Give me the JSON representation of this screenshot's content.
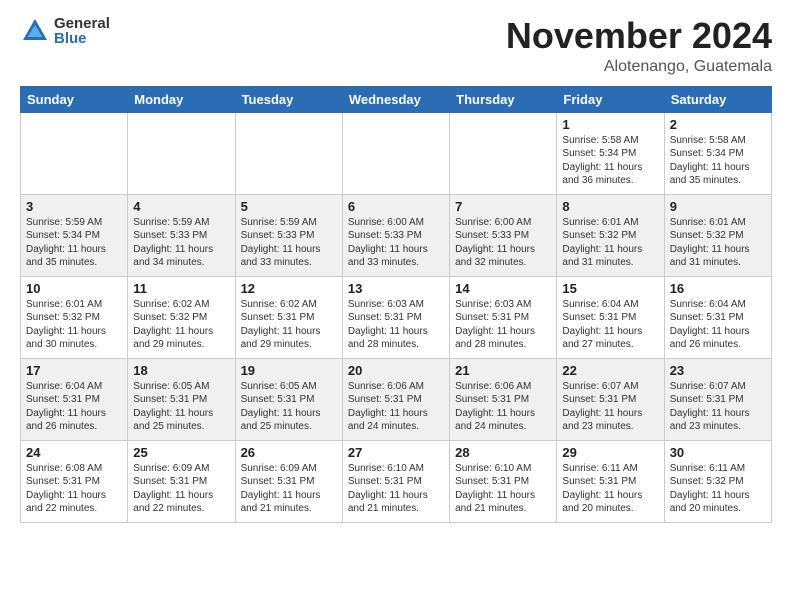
{
  "header": {
    "logo_general": "General",
    "logo_blue": "Blue",
    "month_title": "November 2024",
    "location": "Alotenango, Guatemala"
  },
  "weekdays": [
    "Sunday",
    "Monday",
    "Tuesday",
    "Wednesday",
    "Thursday",
    "Friday",
    "Saturday"
  ],
  "weeks": [
    [
      {
        "day": "",
        "info": ""
      },
      {
        "day": "",
        "info": ""
      },
      {
        "day": "",
        "info": ""
      },
      {
        "day": "",
        "info": ""
      },
      {
        "day": "",
        "info": ""
      },
      {
        "day": "1",
        "info": "Sunrise: 5:58 AM\nSunset: 5:34 PM\nDaylight: 11 hours\nand 36 minutes."
      },
      {
        "day": "2",
        "info": "Sunrise: 5:58 AM\nSunset: 5:34 PM\nDaylight: 11 hours\nand 35 minutes."
      }
    ],
    [
      {
        "day": "3",
        "info": "Sunrise: 5:59 AM\nSunset: 5:34 PM\nDaylight: 11 hours\nand 35 minutes."
      },
      {
        "day": "4",
        "info": "Sunrise: 5:59 AM\nSunset: 5:33 PM\nDaylight: 11 hours\nand 34 minutes."
      },
      {
        "day": "5",
        "info": "Sunrise: 5:59 AM\nSunset: 5:33 PM\nDaylight: 11 hours\nand 33 minutes."
      },
      {
        "day": "6",
        "info": "Sunrise: 6:00 AM\nSunset: 5:33 PM\nDaylight: 11 hours\nand 33 minutes."
      },
      {
        "day": "7",
        "info": "Sunrise: 6:00 AM\nSunset: 5:33 PM\nDaylight: 11 hours\nand 32 minutes."
      },
      {
        "day": "8",
        "info": "Sunrise: 6:01 AM\nSunset: 5:32 PM\nDaylight: 11 hours\nand 31 minutes."
      },
      {
        "day": "9",
        "info": "Sunrise: 6:01 AM\nSunset: 5:32 PM\nDaylight: 11 hours\nand 31 minutes."
      }
    ],
    [
      {
        "day": "10",
        "info": "Sunrise: 6:01 AM\nSunset: 5:32 PM\nDaylight: 11 hours\nand 30 minutes."
      },
      {
        "day": "11",
        "info": "Sunrise: 6:02 AM\nSunset: 5:32 PM\nDaylight: 11 hours\nand 29 minutes."
      },
      {
        "day": "12",
        "info": "Sunrise: 6:02 AM\nSunset: 5:31 PM\nDaylight: 11 hours\nand 29 minutes."
      },
      {
        "day": "13",
        "info": "Sunrise: 6:03 AM\nSunset: 5:31 PM\nDaylight: 11 hours\nand 28 minutes."
      },
      {
        "day": "14",
        "info": "Sunrise: 6:03 AM\nSunset: 5:31 PM\nDaylight: 11 hours\nand 28 minutes."
      },
      {
        "day": "15",
        "info": "Sunrise: 6:04 AM\nSunset: 5:31 PM\nDaylight: 11 hours\nand 27 minutes."
      },
      {
        "day": "16",
        "info": "Sunrise: 6:04 AM\nSunset: 5:31 PM\nDaylight: 11 hours\nand 26 minutes."
      }
    ],
    [
      {
        "day": "17",
        "info": "Sunrise: 6:04 AM\nSunset: 5:31 PM\nDaylight: 11 hours\nand 26 minutes."
      },
      {
        "day": "18",
        "info": "Sunrise: 6:05 AM\nSunset: 5:31 PM\nDaylight: 11 hours\nand 25 minutes."
      },
      {
        "day": "19",
        "info": "Sunrise: 6:05 AM\nSunset: 5:31 PM\nDaylight: 11 hours\nand 25 minutes."
      },
      {
        "day": "20",
        "info": "Sunrise: 6:06 AM\nSunset: 5:31 PM\nDaylight: 11 hours\nand 24 minutes."
      },
      {
        "day": "21",
        "info": "Sunrise: 6:06 AM\nSunset: 5:31 PM\nDaylight: 11 hours\nand 24 minutes."
      },
      {
        "day": "22",
        "info": "Sunrise: 6:07 AM\nSunset: 5:31 PM\nDaylight: 11 hours\nand 23 minutes."
      },
      {
        "day": "23",
        "info": "Sunrise: 6:07 AM\nSunset: 5:31 PM\nDaylight: 11 hours\nand 23 minutes."
      }
    ],
    [
      {
        "day": "24",
        "info": "Sunrise: 6:08 AM\nSunset: 5:31 PM\nDaylight: 11 hours\nand 22 minutes."
      },
      {
        "day": "25",
        "info": "Sunrise: 6:09 AM\nSunset: 5:31 PM\nDaylight: 11 hours\nand 22 minutes."
      },
      {
        "day": "26",
        "info": "Sunrise: 6:09 AM\nSunset: 5:31 PM\nDaylight: 11 hours\nand 21 minutes."
      },
      {
        "day": "27",
        "info": "Sunrise: 6:10 AM\nSunset: 5:31 PM\nDaylight: 11 hours\nand 21 minutes."
      },
      {
        "day": "28",
        "info": "Sunrise: 6:10 AM\nSunset: 5:31 PM\nDaylight: 11 hours\nand 21 minutes."
      },
      {
        "day": "29",
        "info": "Sunrise: 6:11 AM\nSunset: 5:31 PM\nDaylight: 11 hours\nand 20 minutes."
      },
      {
        "day": "30",
        "info": "Sunrise: 6:11 AM\nSunset: 5:32 PM\nDaylight: 11 hours\nand 20 minutes."
      }
    ]
  ]
}
